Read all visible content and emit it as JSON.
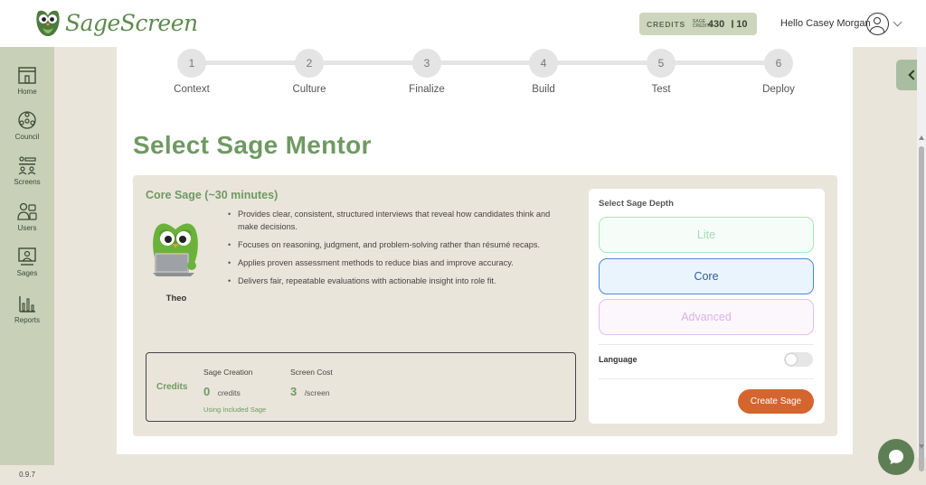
{
  "header": {
    "brand": "SageScreen",
    "credits_label": "CREDITS",
    "sage_mini_label": "SAGE CREDITS",
    "sage_credits": "430",
    "screen_credits": "10",
    "greeting": "Hello Casey Morgan"
  },
  "sidebar": {
    "items": [
      {
        "label": "Home",
        "icon": "home-icon"
      },
      {
        "label": "Council",
        "icon": "council-icon"
      },
      {
        "label": "Screens",
        "icon": "screens-icon"
      },
      {
        "label": "Users",
        "icon": "users-icon"
      },
      {
        "label": "Sages",
        "icon": "sages-icon"
      },
      {
        "label": "Reports",
        "icon": "reports-icon"
      }
    ],
    "version": "0.9.7"
  },
  "stepper": {
    "steps": [
      {
        "num": "1",
        "label": "Context"
      },
      {
        "num": "2",
        "label": "Culture"
      },
      {
        "num": "3",
        "label": "Finalize"
      },
      {
        "num": "4",
        "label": "Build"
      },
      {
        "num": "5",
        "label": "Test"
      },
      {
        "num": "6",
        "label": "Deploy"
      }
    ]
  },
  "main": {
    "title": "Select Sage Mentor",
    "sage_title": "Core Sage (~30 minutes)",
    "mentor_name": "Theo",
    "bullets": [
      "Provides clear, consistent, structured interviews that reveal how candidates think and make decisions.",
      "Focuses on reasoning, judgment, and problem-solving rather than résumé recaps.",
      "Applies proven assessment methods to reduce bias and improve accuracy.",
      "Delivers fair, repeatable evaluations with actionable insight into role fit."
    ],
    "credits": {
      "label": "Credits",
      "creation_header": "Sage Creation",
      "creation_value": "0",
      "creation_unit": "credits",
      "creation_note": "Using Included Sage",
      "cost_header": "Screen Cost",
      "cost_value": "3",
      "cost_unit": "/screen"
    }
  },
  "depth": {
    "title": "Select Sage Depth",
    "options": [
      "Lite",
      "Core",
      "Advanced"
    ],
    "selected": "Core",
    "language_label": "Language",
    "create_label": "Create Sage"
  },
  "colors": {
    "brand_green": "#6f9a63",
    "sidebar_bg": "#c8d0b8",
    "cta_orange": "#d4652f",
    "selected_blue": "#4e86d6"
  }
}
